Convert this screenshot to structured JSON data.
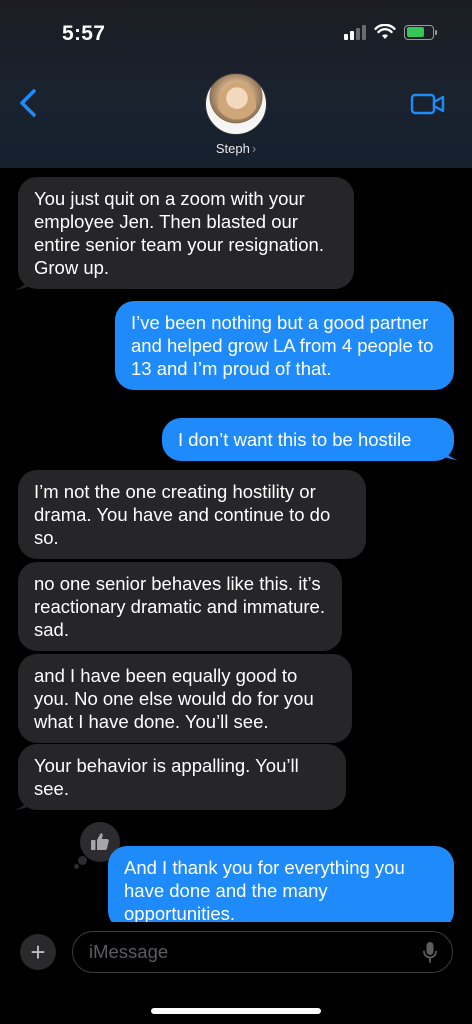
{
  "status_bar": {
    "time": "5:57",
    "icons": [
      "signal-icon",
      "wifi-icon",
      "battery-charging-icon"
    ]
  },
  "header": {
    "back_icon": "chevron-left-icon",
    "contact_name": "Steph",
    "contact_chevron": "›",
    "video_icon": "video-camera-icon"
  },
  "messages": [
    {
      "direction": "incoming",
      "text": "You just quit on a zoom with your employee Jen. Then blasted our entire senior team your resignation. Grow up."
    },
    {
      "direction": "outgoing",
      "text": "I’ve been nothing but a good partner and helped grow LA from 4 people to 13 and I’m proud of that."
    },
    {
      "direction": "outgoing",
      "text": "I don’t want this to be hostile"
    },
    {
      "direction": "incoming",
      "text": "I’m not the one creating hostility or drama.  You have and continue to do so."
    },
    {
      "direction": "incoming",
      "text": "no one senior behaves like this. it’s reactionary dramatic and immature. sad."
    },
    {
      "direction": "incoming",
      "text": "and I have been equally good to you. No one else would do for you what I have done. You’ll see."
    },
    {
      "direction": "incoming",
      "text": "Your behavior is appalling. You’ll see."
    },
    {
      "direction": "outgoing",
      "text": "And I thank you for everything you have done and the many opportunities."
    }
  ],
  "tapback": {
    "icon": "thumbs-up-icon"
  },
  "composer": {
    "placeholder": "iMessage",
    "plus_label": "+",
    "mic_icon": "microphone-icon"
  },
  "colors": {
    "incoming_bubble": "#262629",
    "outgoing_bubble": "#1f8bfa",
    "accent": "#1f8bfa"
  }
}
